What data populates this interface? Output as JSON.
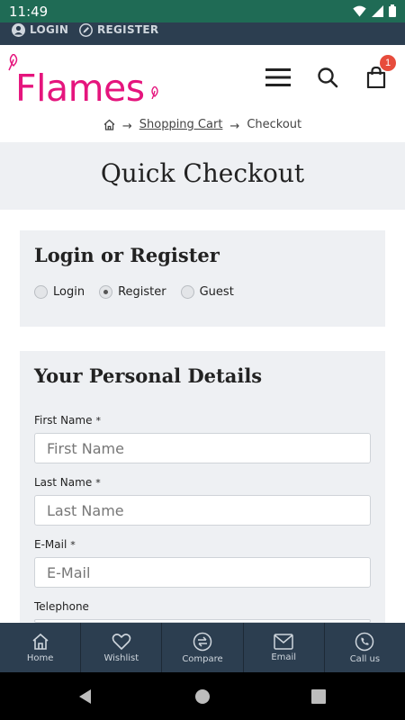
{
  "status_bar": {
    "time": "11:49"
  },
  "topbar": {
    "login_label": "LOGIN",
    "register_label": "REGISTER"
  },
  "header": {
    "logo_text": "Flames",
    "cart_count": "1"
  },
  "breadcrumb": {
    "shopping_cart": "Shopping Cart",
    "checkout": "Checkout",
    "arrow": "→"
  },
  "page": {
    "title": "Quick Checkout"
  },
  "login_panel": {
    "title": "Login or Register",
    "options": [
      {
        "label": "Login",
        "checked": false
      },
      {
        "label": "Register",
        "checked": true
      },
      {
        "label": "Guest",
        "checked": false
      }
    ]
  },
  "personal_details": {
    "title": "Your Personal Details",
    "required_mark": "*",
    "first_name": {
      "label": "First Name",
      "placeholder": "First Name"
    },
    "last_name": {
      "label": "Last Name",
      "placeholder": "Last Name"
    },
    "email": {
      "label": "E-Mail",
      "placeholder": "E-Mail"
    },
    "telephone": {
      "label": "Telephone"
    }
  },
  "bottom_nav": {
    "items": [
      {
        "label": "Home",
        "icon": "home-icon"
      },
      {
        "label": "Wishlist",
        "icon": "heart-icon"
      },
      {
        "label": "Compare",
        "icon": "compare-icon"
      },
      {
        "label": "Email",
        "icon": "mail-icon"
      },
      {
        "label": "Call us",
        "icon": "phone-icon"
      }
    ]
  },
  "colors": {
    "brand": "#e5157d",
    "nav_bg": "#2c3e50",
    "status_bar": "#1f6b55",
    "panel_bg": "#eef0f3"
  }
}
